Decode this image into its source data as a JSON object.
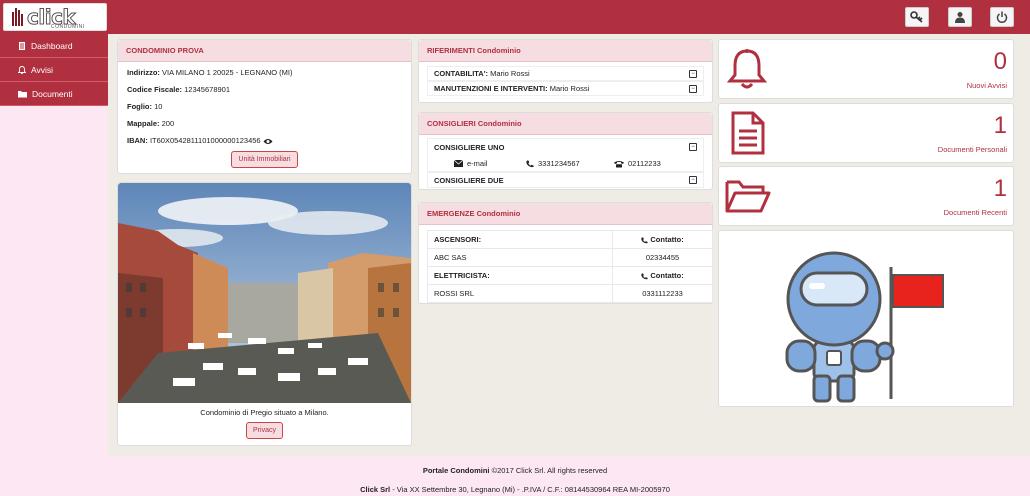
{
  "brand": {
    "logo_text": "click",
    "logo_sub": "CONDOMINI"
  },
  "topbar": {
    "icons": [
      "key-icon",
      "user-icon",
      "power-icon"
    ]
  },
  "sidebar": {
    "items": [
      {
        "label": "Dashboard",
        "icon": "dashboard-icon"
      },
      {
        "label": "Avvisi",
        "icon": "bell-icon"
      },
      {
        "label": "Documenti",
        "icon": "folder-icon"
      }
    ]
  },
  "condominio": {
    "title": "CONDOMINIO PROVA",
    "indirizzo_label": "Indirizzo:",
    "indirizzo": "VIA MILANO 1 20025 - LEGNANO (MI)",
    "cf_label": "Codice Fiscale:",
    "cf": "12345678901",
    "foglio_label": "Foglio:",
    "foglio": "10",
    "mappale_label": "Mappale:",
    "mappale": "200",
    "iban_label": "IBAN:",
    "iban": "IT60X0542811101000000123456",
    "units_button": "Unità Immobiliari"
  },
  "photo": {
    "caption": "Condominio di Pregio situato a Milano.",
    "privacy_button": "Privacy"
  },
  "riferimenti": {
    "title": "RIFERIMENTI Condominio",
    "rows": [
      {
        "label": "CONTABILITA':",
        "name": "Mario Rossi"
      },
      {
        "label": "MANUTENZIONI E INTERVENTI:",
        "name": "Mario Rossi"
      }
    ]
  },
  "consiglieri": {
    "title": "CONSIGLIERI Condominio",
    "items": [
      {
        "name": "CONSIGLIERE UNO",
        "email_label": "e-mail",
        "mobile": "3331234567",
        "phone": "02112233"
      },
      {
        "name": "CONSIGLIERE DUE"
      }
    ]
  },
  "emergenze": {
    "title": "EMERGENZE Condominio",
    "contact_header": "Contatto:",
    "rows": [
      {
        "category": "ASCENSORI:",
        "company": "ABC SAS",
        "contact": "02334455"
      },
      {
        "category": "ELETTRICISTA:",
        "company": "ROSSI SRL",
        "contact": "0331112233"
      }
    ]
  },
  "stats": [
    {
      "value": "0",
      "label": "Nuovi Avvisi",
      "icon": "bell-icon"
    },
    {
      "value": "1",
      "label": "Documenti Personali",
      "icon": "document-icon"
    },
    {
      "value": "1",
      "label": "Documenti Recenti",
      "icon": "open-folder-icon"
    }
  ],
  "footer": {
    "line1_bold": "Portale Condomini",
    "line1_rest": " ©2017 Click Srl. All rights reserved",
    "line2_bold": "Click Srl",
    "line2_rest": " - Via XX Settembre 30, Legnano (Mi) - .P.IVA / C.F.: 08144530964 REA MI-2005970"
  },
  "colors": {
    "brand": "#b13040",
    "panel_header": "#f5dde2",
    "background": "#eeece4"
  }
}
